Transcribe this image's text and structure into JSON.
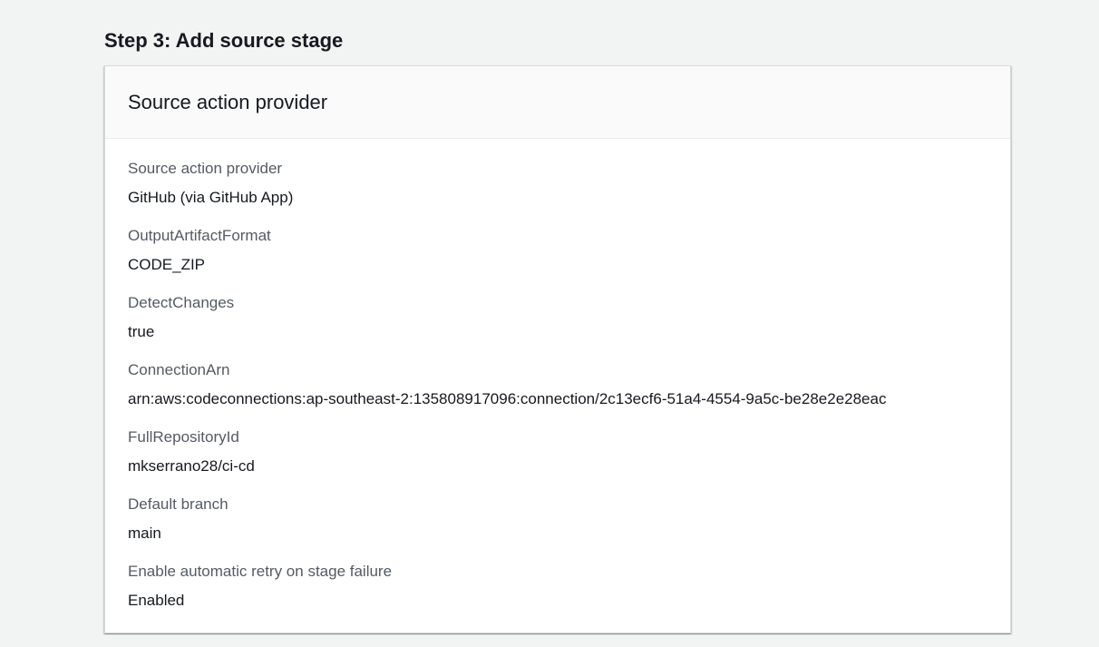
{
  "step_title": "Step 3: Add source stage",
  "panel": {
    "title": "Source action provider",
    "fields": [
      {
        "label": "Source action provider",
        "value": "GitHub (via GitHub App)"
      },
      {
        "label": "OutputArtifactFormat",
        "value": "CODE_ZIP"
      },
      {
        "label": "DetectChanges",
        "value": "true"
      },
      {
        "label": "ConnectionArn",
        "value": "arn:aws:codeconnections:ap-southeast-2:135808917096:connection/2c13ecf6-51a4-4554-9a5c-be28e2e28eac"
      },
      {
        "label": "FullRepositoryId",
        "value": "mkserrano28/ci-cd"
      },
      {
        "label": "Default branch",
        "value": "main"
      },
      {
        "label": "Enable automatic retry on stage failure",
        "value": "Enabled"
      }
    ]
  }
}
